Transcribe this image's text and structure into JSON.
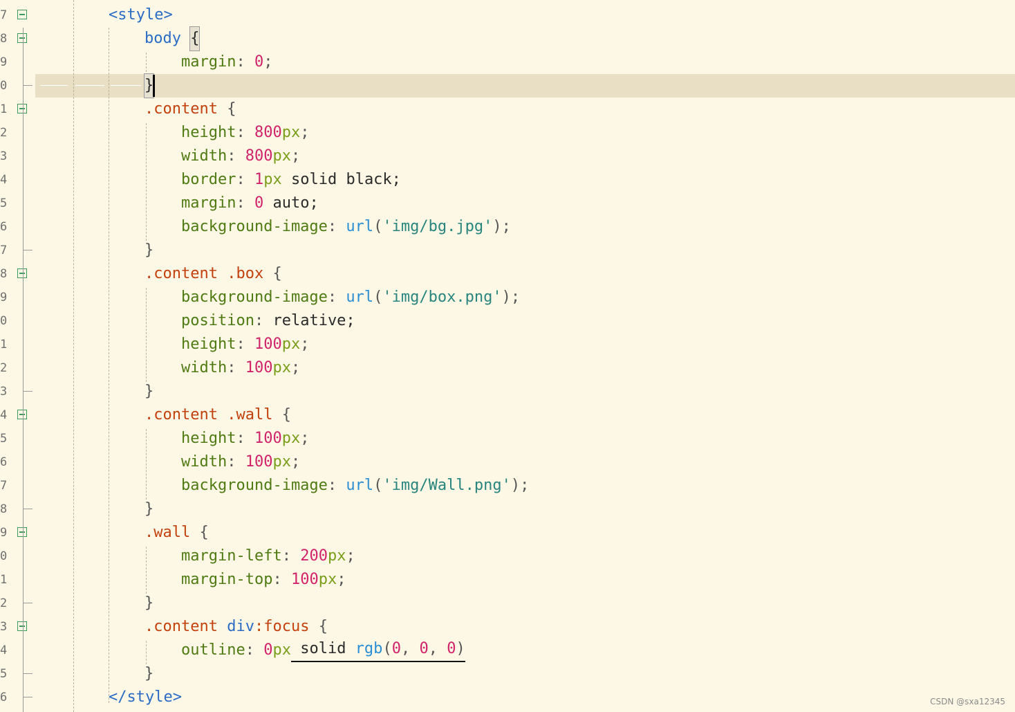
{
  "colors": {
    "background": "#fdf8e5",
    "current_line": "#e8dfc4",
    "tag": "#2a6cc4",
    "selector_class": "#c2410c",
    "property": "#4f7a12",
    "number": "#d1236a",
    "unit": "#7a9e1a",
    "function": "#2a8ed4",
    "string": "#28857e",
    "fold_marker": "#3c9a5a"
  },
  "editor": {
    "current_line_number": "0",
    "lines": [
      {
        "num": "7",
        "fold": "open",
        "indent": 1,
        "tokens": [
          {
            "t": "<style>",
            "c": "tag"
          }
        ]
      },
      {
        "num": "8",
        "fold": "open",
        "indent": 2,
        "tokens": [
          {
            "t": "body",
            "c": "sel"
          },
          {
            "t": " ",
            "c": "plain"
          },
          {
            "t": "{",
            "c": "bm"
          }
        ]
      },
      {
        "num": "9",
        "fold": "none",
        "indent": 3,
        "tokens": [
          {
            "t": "margin",
            "c": "prop"
          },
          {
            "t": ": ",
            "c": "punc"
          },
          {
            "t": "0",
            "c": "num"
          },
          {
            "t": ";",
            "c": "punc"
          }
        ]
      },
      {
        "num": "0",
        "fold": "end",
        "indent": 2,
        "current": true,
        "tokens": [
          {
            "t": "}",
            "c": "bm"
          }
        ]
      },
      {
        "num": "1",
        "fold": "open",
        "indent": 2,
        "tokens": [
          {
            "t": ".content",
            "c": "class"
          },
          {
            "t": " {",
            "c": "brace"
          }
        ]
      },
      {
        "num": "2",
        "fold": "none",
        "indent": 3,
        "tokens": [
          {
            "t": "height",
            "c": "prop"
          },
          {
            "t": ": ",
            "c": "punc"
          },
          {
            "t": "800",
            "c": "num"
          },
          {
            "t": "px",
            "c": "unit"
          },
          {
            "t": ";",
            "c": "punc"
          }
        ]
      },
      {
        "num": "3",
        "fold": "none",
        "indent": 3,
        "tokens": [
          {
            "t": "width",
            "c": "prop"
          },
          {
            "t": ": ",
            "c": "punc"
          },
          {
            "t": "800",
            "c": "num"
          },
          {
            "t": "px",
            "c": "unit"
          },
          {
            "t": ";",
            "c": "punc"
          }
        ]
      },
      {
        "num": "4",
        "fold": "none",
        "indent": 3,
        "tokens": [
          {
            "t": "border",
            "c": "prop"
          },
          {
            "t": ": ",
            "c": "punc"
          },
          {
            "t": "1",
            "c": "num"
          },
          {
            "t": "px",
            "c": "unit"
          },
          {
            "t": " solid black;",
            "c": "plain"
          }
        ]
      },
      {
        "num": "5",
        "fold": "none",
        "indent": 3,
        "tokens": [
          {
            "t": "margin",
            "c": "prop"
          },
          {
            "t": ": ",
            "c": "punc"
          },
          {
            "t": "0",
            "c": "num"
          },
          {
            "t": " auto;",
            "c": "plain"
          }
        ]
      },
      {
        "num": "6",
        "fold": "none",
        "indent": 3,
        "tokens": [
          {
            "t": "background-image",
            "c": "prop"
          },
          {
            "t": ": ",
            "c": "punc"
          },
          {
            "t": "url",
            "c": "fn"
          },
          {
            "t": "(",
            "c": "punc"
          },
          {
            "t": "'img/bg.jpg'",
            "c": "str"
          },
          {
            "t": ");",
            "c": "punc"
          }
        ]
      },
      {
        "num": "7",
        "fold": "end",
        "indent": 2,
        "tokens": [
          {
            "t": "}",
            "c": "brace"
          }
        ]
      },
      {
        "num": "8",
        "fold": "open",
        "indent": 2,
        "tokens": [
          {
            "t": ".content",
            "c": "class"
          },
          {
            "t": " ",
            "c": "plain"
          },
          {
            "t": ".box",
            "c": "class"
          },
          {
            "t": " {",
            "c": "brace"
          }
        ]
      },
      {
        "num": "9",
        "fold": "none",
        "indent": 3,
        "tokens": [
          {
            "t": "background-image",
            "c": "prop"
          },
          {
            "t": ": ",
            "c": "punc"
          },
          {
            "t": "url",
            "c": "fn"
          },
          {
            "t": "(",
            "c": "punc"
          },
          {
            "t": "'img/box.png'",
            "c": "str"
          },
          {
            "t": ");",
            "c": "punc"
          }
        ]
      },
      {
        "num": "0",
        "fold": "none",
        "indent": 3,
        "tokens": [
          {
            "t": "position",
            "c": "prop"
          },
          {
            "t": ": ",
            "c": "punc"
          },
          {
            "t": "relative;",
            "c": "plain"
          }
        ]
      },
      {
        "num": "1",
        "fold": "none",
        "indent": 3,
        "tokens": [
          {
            "t": "height",
            "c": "prop"
          },
          {
            "t": ": ",
            "c": "punc"
          },
          {
            "t": "100",
            "c": "num"
          },
          {
            "t": "px",
            "c": "unit"
          },
          {
            "t": ";",
            "c": "punc"
          }
        ]
      },
      {
        "num": "2",
        "fold": "none",
        "indent": 3,
        "tokens": [
          {
            "t": "width",
            "c": "prop"
          },
          {
            "t": ": ",
            "c": "punc"
          },
          {
            "t": "100",
            "c": "num"
          },
          {
            "t": "px",
            "c": "unit"
          },
          {
            "t": ";",
            "c": "punc"
          }
        ]
      },
      {
        "num": "3",
        "fold": "end",
        "indent": 2,
        "tokens": [
          {
            "t": "}",
            "c": "brace"
          }
        ]
      },
      {
        "num": "4",
        "fold": "open",
        "indent": 2,
        "tokens": [
          {
            "t": ".content",
            "c": "class"
          },
          {
            "t": " ",
            "c": "plain"
          },
          {
            "t": ".wall",
            "c": "class"
          },
          {
            "t": " {",
            "c": "brace"
          }
        ]
      },
      {
        "num": "5",
        "fold": "none",
        "indent": 3,
        "tokens": [
          {
            "t": "height",
            "c": "prop"
          },
          {
            "t": ": ",
            "c": "punc"
          },
          {
            "t": "100",
            "c": "num"
          },
          {
            "t": "px",
            "c": "unit"
          },
          {
            "t": ";",
            "c": "punc"
          }
        ]
      },
      {
        "num": "6",
        "fold": "none",
        "indent": 3,
        "tokens": [
          {
            "t": "width",
            "c": "prop"
          },
          {
            "t": ": ",
            "c": "punc"
          },
          {
            "t": "100",
            "c": "num"
          },
          {
            "t": "px",
            "c": "unit"
          },
          {
            "t": ";",
            "c": "punc"
          }
        ]
      },
      {
        "num": "7",
        "fold": "none",
        "indent": 3,
        "tokens": [
          {
            "t": "background-image",
            "c": "prop"
          },
          {
            "t": ": ",
            "c": "punc"
          },
          {
            "t": "url",
            "c": "fn"
          },
          {
            "t": "(",
            "c": "punc"
          },
          {
            "t": "'img/Wall.png'",
            "c": "str"
          },
          {
            "t": ");",
            "c": "punc"
          }
        ]
      },
      {
        "num": "8",
        "fold": "end",
        "indent": 2,
        "tokens": [
          {
            "t": "}",
            "c": "brace"
          }
        ]
      },
      {
        "num": "9",
        "fold": "open",
        "indent": 2,
        "tokens": [
          {
            "t": ".wall",
            "c": "class"
          },
          {
            "t": " {",
            "c": "brace"
          }
        ]
      },
      {
        "num": "0",
        "fold": "none",
        "indent": 3,
        "tokens": [
          {
            "t": "margin-left",
            "c": "prop"
          },
          {
            "t": ": ",
            "c": "punc"
          },
          {
            "t": "200",
            "c": "num"
          },
          {
            "t": "px",
            "c": "unit"
          },
          {
            "t": ";",
            "c": "punc"
          }
        ]
      },
      {
        "num": "1",
        "fold": "none",
        "indent": 3,
        "tokens": [
          {
            "t": "margin-top",
            "c": "prop"
          },
          {
            "t": ": ",
            "c": "punc"
          },
          {
            "t": "100",
            "c": "num"
          },
          {
            "t": "px",
            "c": "unit"
          },
          {
            "t": ";",
            "c": "punc"
          }
        ]
      },
      {
        "num": "2",
        "fold": "end",
        "indent": 2,
        "tokens": [
          {
            "t": "}",
            "c": "brace"
          }
        ]
      },
      {
        "num": "3",
        "fold": "open",
        "indent": 2,
        "tokens": [
          {
            "t": ".content",
            "c": "class"
          },
          {
            "t": " ",
            "c": "plain"
          },
          {
            "t": "div",
            "c": "sel"
          },
          {
            "t": ":focus",
            "c": "pse"
          },
          {
            "t": " {",
            "c": "brace"
          }
        ]
      },
      {
        "num": "4",
        "fold": "none",
        "indent": 3,
        "underline_from": 4,
        "tokens": [
          {
            "t": "outline",
            "c": "prop"
          },
          {
            "t": ": ",
            "c": "punc"
          },
          {
            "t": "0",
            "c": "num"
          },
          {
            "t": "px",
            "c": "unit"
          },
          {
            "t": " solid ",
            "c": "plain"
          },
          {
            "t": "rgb",
            "c": "fn"
          },
          {
            "t": "(",
            "c": "punc"
          },
          {
            "t": "0",
            "c": "num"
          },
          {
            "t": ", ",
            "c": "punc"
          },
          {
            "t": "0",
            "c": "num"
          },
          {
            "t": ", ",
            "c": "punc"
          },
          {
            "t": "0",
            "c": "num"
          },
          {
            "t": ")",
            "c": "punc"
          }
        ]
      },
      {
        "num": "5",
        "fold": "end",
        "indent": 2,
        "tokens": [
          {
            "t": "}",
            "c": "brace"
          }
        ]
      },
      {
        "num": "6",
        "fold": "end",
        "indent": 1,
        "tokens": [
          {
            "t": "</style>",
            "c": "tag"
          }
        ]
      }
    ]
  },
  "watermark": "CSDN @sxa12345"
}
